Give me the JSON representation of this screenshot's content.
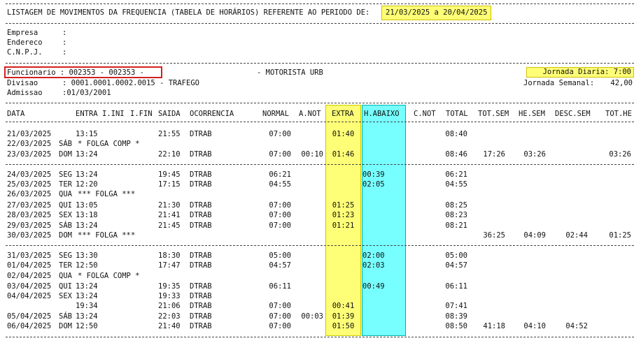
{
  "header": {
    "title": "LISTAGEM DE MOVIMENTOS DA FREQUENCIA (TABELA DE HORÁRIOS) REFERENTE AO PERIODO DE:",
    "period": "21/03/2025 a 20/04/2025"
  },
  "company": {
    "empresa_label": "Empresa",
    "endereco_label": "Endereco",
    "cnpj_label": "C.N.P.J.",
    "colon": ":"
  },
  "employee": {
    "funcionario": "Funcionario : 002353 - 002353 -",
    "cargo": "- MOTORISTA URB",
    "divisao_label": "Divisao",
    "divisao_value": ": 0001.0001.0002.0015 - TRAFEGO",
    "admissao_label": "Admissao",
    "admissao_value": ":01/03/2001",
    "jornada_diaria": "Jornada Diaria: 7:00",
    "jornada_semanal_label": "Jornada Semanal:",
    "jornada_semanal_value": "42,00"
  },
  "columns": [
    "DATA",
    "ENTRA",
    "I.INI",
    "I.FIN",
    "SAIDA",
    "OCORRENCIA",
    "NORMAL",
    "A.NOT",
    "EXTRA",
    "H.ABAIXO",
    "C.NOT",
    "TOTAL",
    "TOT.SEM",
    "HE.SEM",
    "DESC.SEM",
    "TOT.HE"
  ],
  "rows": [
    {
      "date": "21/03/2025",
      "day": "",
      "entra": "13:15",
      "saida": "21:55",
      "ocor": "DTRAB",
      "normal": "07:00",
      "anot": "",
      "extra": "01:40",
      "habaixo": "",
      "total": "08:40",
      "totsem": "",
      "hesem": "",
      "descsem": "",
      "tothe": "",
      "note": ""
    },
    {
      "date": "22/03/2025",
      "day": "SÁB",
      "entra": "",
      "saida": "",
      "ocor": "",
      "normal": "",
      "anot": "",
      "extra": "",
      "habaixo": "",
      "total": "",
      "totsem": "",
      "hesem": "",
      "descsem": "",
      "tothe": "",
      "note": "* FOLGA COMP *"
    },
    {
      "date": "23/03/2025",
      "day": "DOM",
      "entra": "13:24",
      "saida": "22:10",
      "ocor": "DTRAB",
      "normal": "07:00",
      "anot": "00:10",
      "extra": "01:46",
      "habaixo": "",
      "total": "08:46",
      "totsem": "17:26",
      "hesem": "03:26",
      "descsem": "",
      "tothe": "03:26",
      "note": ""
    },
    {
      "date": "24/03/2025",
      "day": "SEG",
      "entra": "13:24",
      "saida": "19:45",
      "ocor": "DTRAB",
      "normal": "06:21",
      "anot": "",
      "extra": "",
      "habaixo": "00:39",
      "total": "06:21",
      "totsem": "",
      "hesem": "",
      "descsem": "",
      "tothe": "",
      "note": ""
    },
    {
      "date": "25/03/2025",
      "day": "TER",
      "entra": "12:20",
      "saida": "17:15",
      "ocor": "DTRAB",
      "normal": "04:55",
      "anot": "",
      "extra": "",
      "habaixo": "02:05",
      "total": "04:55",
      "totsem": "",
      "hesem": "",
      "descsem": "",
      "tothe": "",
      "note": ""
    },
    {
      "date": "26/03/2025",
      "day": "QUA",
      "entra": "",
      "saida": "",
      "ocor": "",
      "normal": "",
      "anot": "",
      "extra": "",
      "habaixo": "",
      "total": "",
      "totsem": "",
      "hesem": "",
      "descsem": "",
      "tothe": "",
      "note": "*** FOLGA ***"
    },
    {
      "date": "27/03/2025",
      "day": "QUI",
      "entra": "13:05",
      "saida": "21:30",
      "ocor": "DTRAB",
      "normal": "07:00",
      "anot": "",
      "extra": "01:25",
      "habaixo": "",
      "total": "08:25",
      "totsem": "",
      "hesem": "",
      "descsem": "",
      "tothe": "",
      "note": ""
    },
    {
      "date": "28/03/2025",
      "day": "SEX",
      "entra": "13:18",
      "saida": "21:41",
      "ocor": "DTRAB",
      "normal": "07:00",
      "anot": "",
      "extra": "01:23",
      "habaixo": "",
      "total": "08:23",
      "totsem": "",
      "hesem": "",
      "descsem": "",
      "tothe": "",
      "note": ""
    },
    {
      "date": "29/03/2025",
      "day": "SÁB",
      "entra": "13:24",
      "saida": "21:45",
      "ocor": "DTRAB",
      "normal": "07:00",
      "anot": "",
      "extra": "01:21",
      "habaixo": "",
      "total": "08:21",
      "totsem": "",
      "hesem": "",
      "descsem": "",
      "tothe": "",
      "note": ""
    },
    {
      "date": "30/03/2025",
      "day": "DOM",
      "entra": "",
      "saida": "",
      "ocor": "",
      "normal": "",
      "anot": "",
      "extra": "",
      "habaixo": "",
      "total": "",
      "totsem": "36:25",
      "hesem": "04:09",
      "descsem": "02:44",
      "tothe": "01:25",
      "note": "*** FOLGA ***"
    },
    {
      "date": "31/03/2025",
      "day": "SEG",
      "entra": "13:30",
      "saida": "18:30",
      "ocor": "DTRAB",
      "normal": "05:00",
      "anot": "",
      "extra": "",
      "habaixo": "02:00",
      "total": "05:00",
      "totsem": "",
      "hesem": "",
      "descsem": "",
      "tothe": "",
      "note": ""
    },
    {
      "date": "01/04/2025",
      "day": "TER",
      "entra": "12:50",
      "saida": "17:47",
      "ocor": "DTRAB",
      "normal": "04:57",
      "anot": "",
      "extra": "",
      "habaixo": "02:03",
      "total": "04:57",
      "totsem": "",
      "hesem": "",
      "descsem": "",
      "tothe": "",
      "note": ""
    },
    {
      "date": "02/04/2025",
      "day": "QUA",
      "entra": "",
      "saida": "",
      "ocor": "",
      "normal": "",
      "anot": "",
      "extra": "",
      "habaixo": "",
      "total": "",
      "totsem": "",
      "hesem": "",
      "descsem": "",
      "tothe": "",
      "note": "* FOLGA COMP *"
    },
    {
      "date": "03/04/2025",
      "day": "QUI",
      "entra": "13:24",
      "saida": "19:35",
      "ocor": "DTRAB",
      "normal": "06:11",
      "anot": "",
      "extra": "",
      "habaixo": "00:49",
      "total": "06:11",
      "totsem": "",
      "hesem": "",
      "descsem": "",
      "tothe": "",
      "note": ""
    },
    {
      "date": "04/04/2025",
      "day": "SEX",
      "entra": "13:24",
      "saida": "19:33",
      "ocor": "DTRAB",
      "normal": "",
      "anot": "",
      "extra": "",
      "habaixo": "",
      "total": "",
      "totsem": "",
      "hesem": "",
      "descsem": "",
      "tothe": "",
      "note": ""
    },
    {
      "date": "",
      "day": "",
      "entra": "19:34",
      "saida": "21:06",
      "ocor": "DTRAB",
      "normal": "07:00",
      "anot": "",
      "extra": "00:41",
      "habaixo": "",
      "total": "07:41",
      "totsem": "",
      "hesem": "",
      "descsem": "",
      "tothe": "",
      "note": ""
    },
    {
      "date": "05/04/2025",
      "day": "SÁB",
      "entra": "13:24",
      "saida": "22:03",
      "ocor": "DTRAB",
      "normal": "07:00",
      "anot": "00:03",
      "extra": "01:39",
      "habaixo": "",
      "total": "08:39",
      "totsem": "",
      "hesem": "",
      "descsem": "",
      "tothe": "",
      "note": ""
    },
    {
      "date": "06/04/2025",
      "day": "DOM",
      "entra": "12:50",
      "saida": "21:40",
      "ocor": "DTRAB",
      "normal": "07:00",
      "anot": "",
      "extra": "01:50",
      "habaixo": "",
      "total": "08:50",
      "totsem": "41:18",
      "hesem": "04:10",
      "descsem": "04:52",
      "tothe": "",
      "note": ""
    }
  ]
}
